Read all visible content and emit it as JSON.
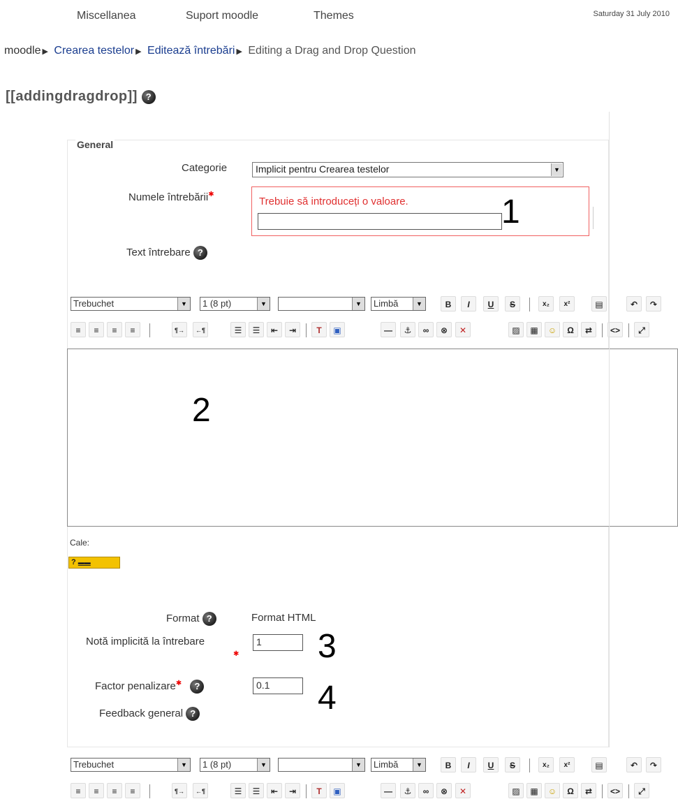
{
  "nav": {
    "items": [
      "Miscellanea",
      "Suport moodle",
      "Themes"
    ],
    "date": "Saturday 31 July 2010"
  },
  "breadcrumb": {
    "home": "moodle",
    "items": [
      "Crearea testelor",
      "Editează întrebări"
    ],
    "current": "Editing a Drag and Drop Question",
    "separator": "▶"
  },
  "page_title": "[[addingdragdrop]]",
  "form": {
    "legend": "General",
    "category_label": "Categorie",
    "category_value": "Implicit pentru Crearea testelor",
    "question_name_label": "Numele întrebării",
    "question_name_error": "Trebuie să introduceți o valoare.",
    "question_name_value": "",
    "question_text_label": "Text întrebare",
    "path_label": "Cale:",
    "path_badge": "?",
    "format_label": "Format",
    "format_value": "Format HTML",
    "default_grade_label": "Notă implicită la întrebare",
    "default_grade_value": "1",
    "penalty_label": "Factor penalizare",
    "penalty_value": "0.1",
    "feedback_label": "Feedback general"
  },
  "editor_toolbar": {
    "font_family": "Trebuchet",
    "font_size": "1 (8 pt)",
    "heading": "",
    "language": "Limbă",
    "bold": "B",
    "italic": "I",
    "underline": "U",
    "strike": "S"
  },
  "annotations": {
    "n1": "1",
    "n2": "2",
    "n3": "3",
    "n4": "4"
  },
  "icons": {
    "help": "help-icon",
    "dropdown": "chevron-down-icon"
  },
  "colors": {
    "error": "#e03030",
    "link": "#1a3d8f",
    "badge": "#f3c200"
  }
}
